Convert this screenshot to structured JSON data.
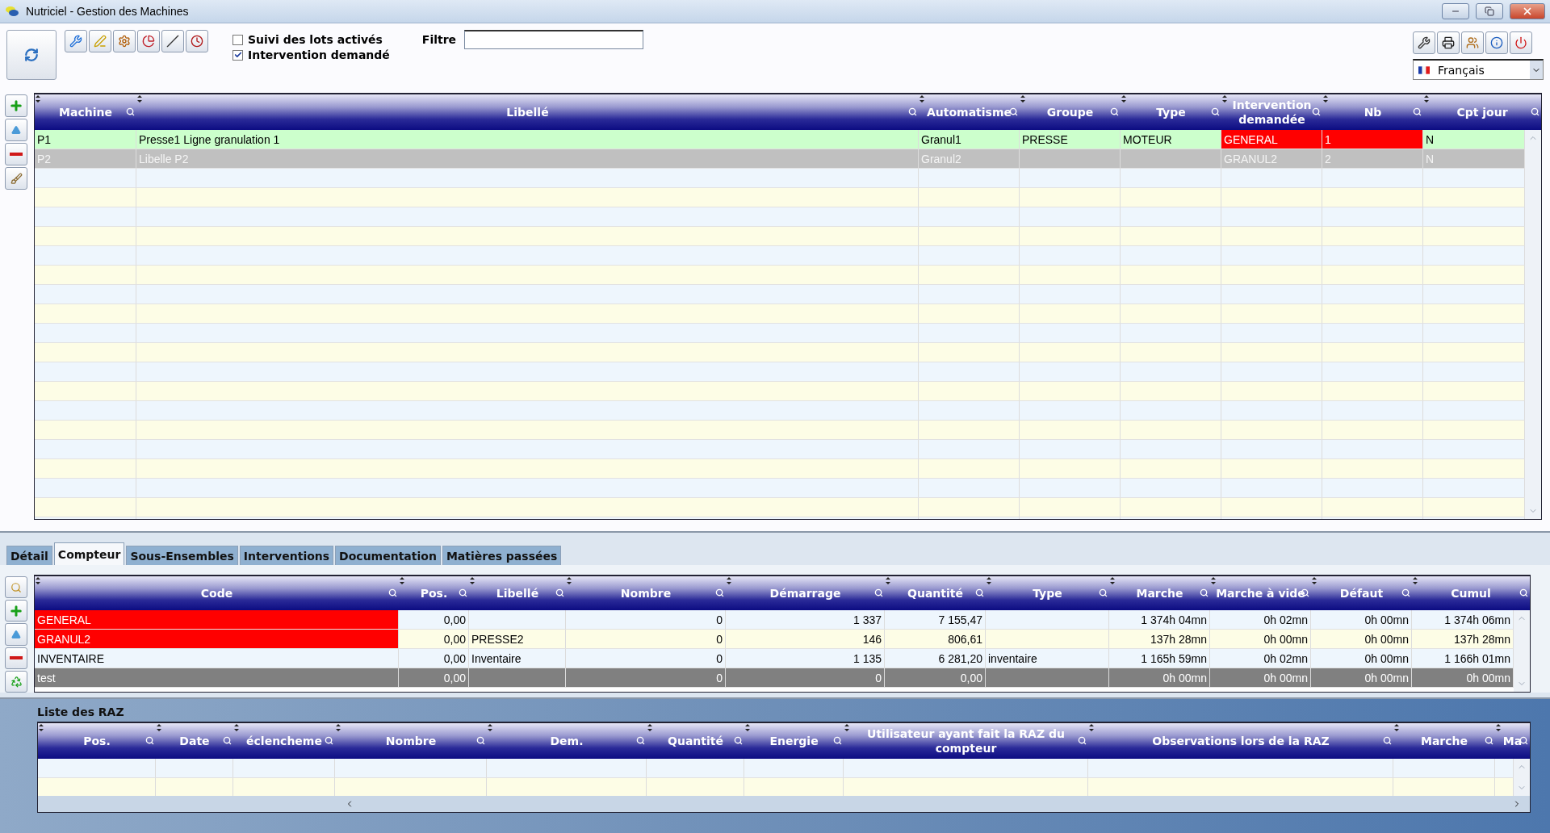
{
  "window": {
    "title": "Nutriciel - Gestion des Machines"
  },
  "options": [
    {
      "label": "Suivi des lots activés",
      "checked": false
    },
    {
      "label": "Intervention demandé",
      "checked": true
    }
  ],
  "filter": {
    "label": "Filtre"
  },
  "language": {
    "value": "Français"
  },
  "main_table": {
    "columns": [
      "Machine",
      "Libellé",
      "Automatisme",
      "Groupe",
      "Type",
      "Intervention demandée",
      "Nb",
      "Cpt jour"
    ],
    "rows": [
      {
        "cells": [
          "P1",
          "Presse1 Ligne granulation 1",
          "Granul1",
          "PRESSE",
          "MOTEUR",
          "GENERAL",
          "1",
          "N"
        ],
        "selected": true,
        "inactive": false,
        "alert": true
      },
      {
        "cells": [
          "P2",
          "Libelle P2",
          "Granul2",
          "",
          "",
          "GRANUL2",
          "2",
          "N"
        ],
        "selected": false,
        "inactive": true,
        "alert": false
      }
    ]
  },
  "tabs": [
    {
      "label": "Détail",
      "selected": false
    },
    {
      "label": "Compteur",
      "selected": true
    },
    {
      "label": "Sous-Ensembles",
      "selected": false
    },
    {
      "label": "Interventions",
      "selected": false
    },
    {
      "label": "Documentation",
      "selected": false
    },
    {
      "label": "Matières passées",
      "selected": false
    }
  ],
  "counter_table": {
    "columns": [
      "Code",
      "Pos.",
      "Libellé",
      "Nombre",
      "Démarrage",
      "Quantité",
      "Type",
      "Marche",
      "Marche à vide",
      "Défaut",
      "Cumul"
    ],
    "rows": [
      {
        "cells": [
          "GENERAL",
          "0,00",
          "",
          "0",
          "1 337",
          "7 155,47",
          "",
          "1 374h 04mn",
          "0h 02mn",
          "0h 00mn",
          "1 374h 06mn"
        ],
        "alert": true,
        "selected": false
      },
      {
        "cells": [
          "GRANUL2",
          "0,00",
          "PRESSE2",
          "0",
          "146",
          "806,61",
          "",
          "137h 28mn",
          "0h 00mn",
          "0h 00mn",
          "137h 28mn"
        ],
        "alert": true,
        "selected": false
      },
      {
        "cells": [
          "INVENTAIRE",
          "0,00",
          "Inventaire",
          "0",
          "1 135",
          "6 281,20",
          "inventaire",
          "1 165h 59mn",
          "0h 02mn",
          "0h 00mn",
          "1 166h 01mn"
        ],
        "alert": false,
        "selected": false
      },
      {
        "cells": [
          "test",
          "0,00",
          "",
          "0",
          "0",
          "0,00",
          "",
          "0h 00mn",
          "0h 00mn",
          "0h 00mn",
          "0h 00mn"
        ],
        "alert": false,
        "selected": true
      }
    ]
  },
  "raz": {
    "title": "Liste des RAZ",
    "columns": [
      "Pos.",
      "Date",
      "éclencheme",
      "Nombre",
      "Dem.",
      "Quantité",
      "Energie",
      "Utilisateur ayant fait la RAZ du compteur",
      "Observations lors de la RAZ",
      "Marche",
      "Ma"
    ]
  }
}
